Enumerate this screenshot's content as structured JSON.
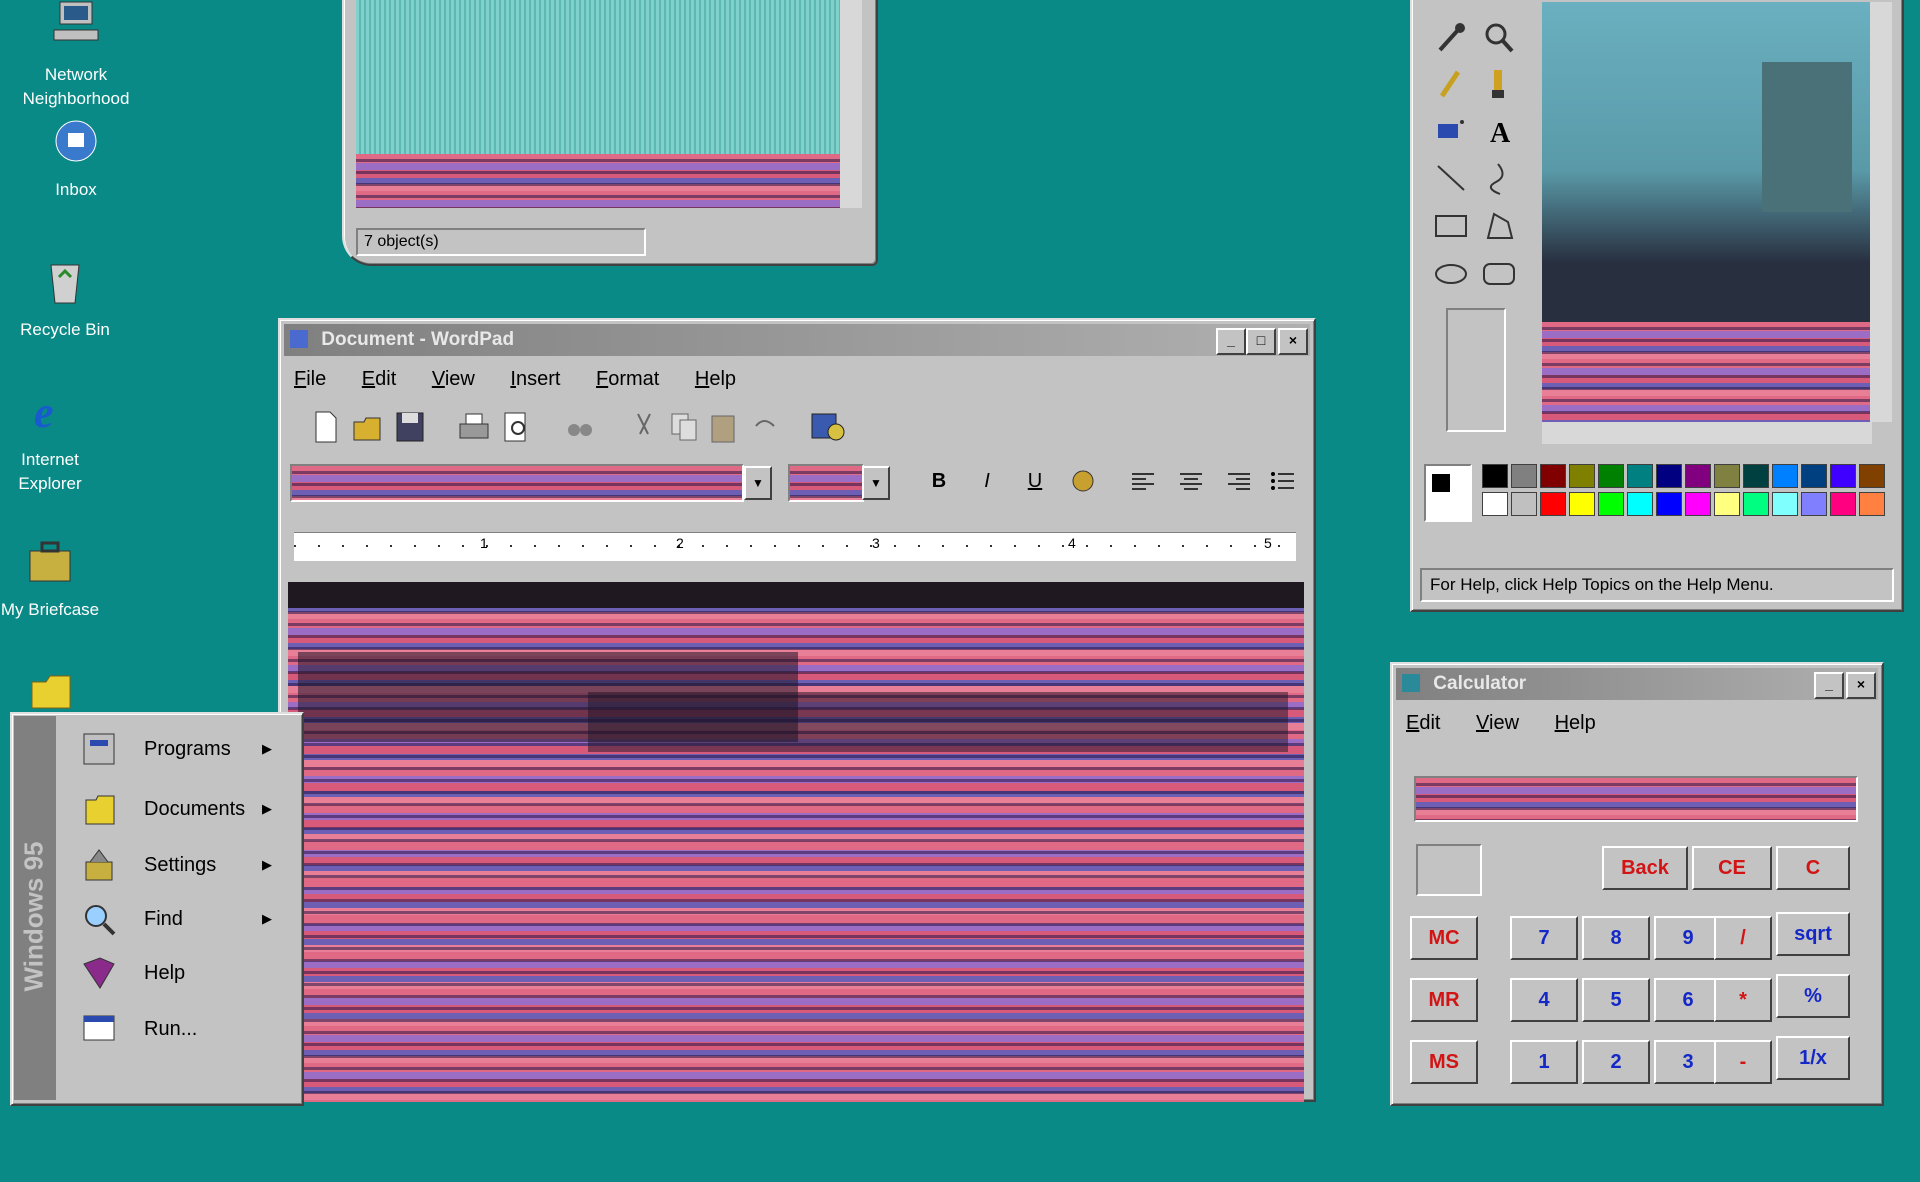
{
  "desktop": {
    "icons": [
      {
        "label": "Network Neighborhood",
        "icon": "network-icon"
      },
      {
        "label": "Inbox",
        "icon": "inbox-icon"
      },
      {
        "label": "Recycle Bin",
        "icon": "recycle-bin-icon"
      },
      {
        "label": "Internet Explorer",
        "icon": "internet-explorer-icon"
      },
      {
        "label": "My Briefcase",
        "icon": "briefcase-icon"
      }
    ]
  },
  "explorer_window": {
    "status_text": "7 object(s)"
  },
  "wordpad": {
    "title": "Document - WordPad",
    "menu": [
      "File",
      "Edit",
      "View",
      "Insert",
      "Format",
      "Help"
    ],
    "toolbar_icons": [
      "new-icon",
      "open-icon",
      "save-icon",
      "print-icon",
      "print-preview-icon",
      "find-icon",
      "cut-icon",
      "copy-icon",
      "paste-icon",
      "undo-icon",
      "date-time-icon"
    ],
    "format_buttons": [
      "B",
      "I",
      "U"
    ],
    "ruler_numbers": [
      "1",
      "2",
      "3",
      "4",
      "5"
    ]
  },
  "paint": {
    "status_text": "For Help, click Help Topics on the Help Menu.",
    "tools": [
      "free-select-icon",
      "select-icon",
      "eraser-icon",
      "fill-icon",
      "pick-color-icon",
      "magnifier-icon",
      "pencil-icon",
      "brush-icon",
      "airbrush-icon",
      "text-icon",
      "line-icon",
      "curve-icon",
      "rectangle-icon",
      "polygon-icon",
      "ellipse-icon",
      "rounded-rect-icon"
    ],
    "palette_top": [
      "#000000",
      "#808080",
      "#800000",
      "#808000",
      "#008000",
      "#008080",
      "#000080",
      "#800080",
      "#808040",
      "#004040",
      "#0080ff",
      "#004080",
      "#4000ff",
      "#804000"
    ],
    "palette_bottom": [
      "#ffffff",
      "#c0c0c0",
      "#ff0000",
      "#ffff00",
      "#00ff00",
      "#00ffff",
      "#0000ff",
      "#ff00ff",
      "#ffff80",
      "#00ff80",
      "#80ffff",
      "#8080ff",
      "#ff0080",
      "#ff8040"
    ]
  },
  "calculator": {
    "title": "Calculator",
    "menu": [
      "Edit",
      "View",
      "Help"
    ],
    "buttons": {
      "back": "Back",
      "ce": "CE",
      "c": "C",
      "mc": "MC",
      "mr": "MR",
      "ms": "MS",
      "n7": "7",
      "n8": "8",
      "n9": "9",
      "div": "/",
      "sqrt": "sqrt",
      "n4": "4",
      "n5": "5",
      "n6": "6",
      "mul": "*",
      "pct": "%",
      "n1": "1",
      "n2": "2",
      "n3": "3",
      "sub": "-",
      "inv": "1/x"
    }
  },
  "start_menu": {
    "banner": "Windows 95",
    "items": [
      {
        "label": "Programs",
        "icon": "programs-icon",
        "submenu": true
      },
      {
        "label": "Documents",
        "icon": "documents-icon",
        "submenu": true
      },
      {
        "label": "Settings",
        "icon": "settings-icon",
        "submenu": true
      },
      {
        "label": "Find",
        "icon": "find-icon",
        "submenu": true
      },
      {
        "label": "Help",
        "icon": "help-book-icon",
        "submenu": false
      },
      {
        "label": "Run...",
        "icon": "run-icon",
        "submenu": false
      }
    ]
  }
}
